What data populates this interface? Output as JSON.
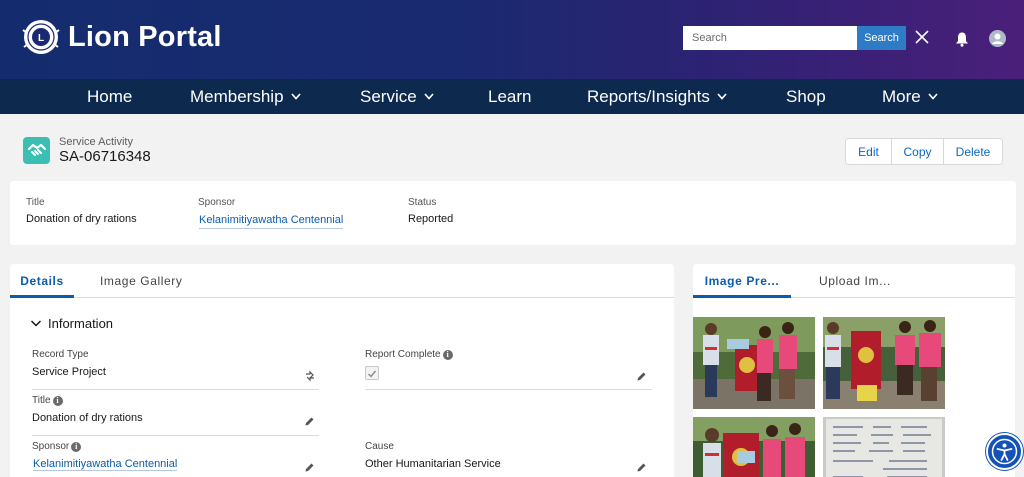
{
  "header": {
    "logo_text": "Lion Portal",
    "search_placeholder": "Search",
    "search_button": "Search"
  },
  "nav": {
    "items": [
      {
        "label": "Home",
        "dropdown": false
      },
      {
        "label": "Membership",
        "dropdown": true
      },
      {
        "label": "Service",
        "dropdown": true
      },
      {
        "label": "Learn",
        "dropdown": false
      },
      {
        "label": "Reports/Insights",
        "dropdown": true
      },
      {
        "label": "Shop",
        "dropdown": false
      },
      {
        "label": "More",
        "dropdown": true
      }
    ]
  },
  "record": {
    "type_label": "Service Activity",
    "name": "SA-06716348",
    "actions": {
      "edit": "Edit",
      "copy": "Copy",
      "delete": "Delete"
    }
  },
  "highlights": {
    "title_label": "Title",
    "title_value": "Donation of dry rations",
    "sponsor_label": "Sponsor",
    "sponsor_value": "Kelanimitiyawatha Centennial",
    "status_label": "Status",
    "status_value": "Reported"
  },
  "details_tabs": {
    "details": "Details",
    "gallery": "Image Gallery"
  },
  "information": {
    "section_title": "Information",
    "record_type_label": "Record Type",
    "record_type_value": "Service Project",
    "report_complete_label": "Report Complete",
    "report_complete_checked": true,
    "title_label": "Title",
    "title_value": "Donation of dry rations",
    "sponsor_label": "Sponsor",
    "sponsor_value": "Kelanimitiyawatha Centennial",
    "cause_label": "Cause",
    "cause_value": "Other Humanitarian Service"
  },
  "image_tabs": {
    "preview": "Image Pre...",
    "upload": "Upload Im..."
  },
  "icons": {
    "logo": "lions-club-emblem-icon",
    "close": "close-icon",
    "bell": "bell-icon",
    "user": "user-avatar-icon",
    "chevron": "chevron-down-icon",
    "record": "handshake-icon",
    "pencil": "pencil-icon",
    "info": "info-icon",
    "record_type_change": "change-record-type-icon",
    "accessibility": "accessibility-icon"
  },
  "colors": {
    "header_start": "#142c6e",
    "header_end": "#4a1f7a",
    "nav_bg": "#0d2a4e",
    "accent": "#0b5cab",
    "search_button": "#2f7cc6",
    "record_icon": "#3bbfb2"
  }
}
